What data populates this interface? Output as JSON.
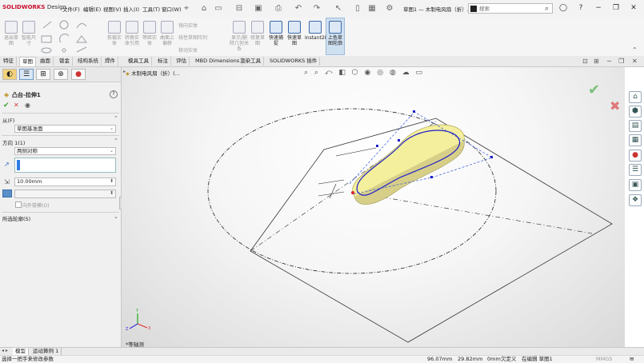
{
  "app": {
    "brand": "SOLIDWORKS",
    "brand_suffix": "Design",
    "menus": [
      "文件(F)",
      "编辑(E)",
      "视图(V)",
      "插入(I)",
      "工具(T)",
      "窗口(W)"
    ],
    "doc_title": "草图1 — 木制电风扇（折）...",
    "search_placeholder": "搜索"
  },
  "ribbon": {
    "groups": [
      {
        "label": "退出草图",
        "enabled": false
      },
      {
        "label": "智能尺寸",
        "enabled": false
      },
      {
        "label": "剪裁实体",
        "enabled": false
      },
      {
        "label": "转换实体引用",
        "enabled": false
      },
      {
        "label": "等距实体",
        "enabled": false
      },
      {
        "label": "曲面上偏移",
        "enabled": false
      },
      {
        "label": "修复草图",
        "enabled": false
      },
      {
        "label": "快速捕捉",
        "enabled": true
      },
      {
        "label": "快速草图",
        "enabled": true
      },
      {
        "label": "Instant2D",
        "enabled": true
      },
      {
        "label": "上色草图轮廓",
        "enabled": true
      }
    ],
    "small_items": [
      "镜向实体",
      "线性草图阵列",
      "移动实体",
      "显示/删除几何关系"
    ]
  },
  "tabs": [
    "特征",
    "草图",
    "曲面",
    "钣金",
    "结构系统",
    "焊件",
    "模具工具",
    "标注",
    "评估",
    "MBD Dimensions",
    "渲染工具",
    "SOLIDWORKS 插件"
  ],
  "active_tab": "草图",
  "property_manager": {
    "feature_title": "凸台-拉伸1",
    "help": "?",
    "from_label": "从(F)",
    "from_value": "草图基准面",
    "direction_label": "方向 1(1)",
    "direction_value": "两侧对称",
    "depth_value": "10.00mm",
    "draft_outward_label": "向外拔模(O)",
    "selected_contours_label": "所选轮廓(S)"
  },
  "graphics": {
    "breadcrumb": "木制电风扇（折）(...",
    "view_label": "*等轴测"
  },
  "bottom_tabs": [
    "模型",
    "运动算例 1"
  ],
  "active_bottom_tab": "模型",
  "status": {
    "hint": "选择一把手来修改参数",
    "x": "96.07mm",
    "y": "29.82mm",
    "z": "0mm",
    "state": "欠定义",
    "editing": "在编辑 草图1",
    "units": "MMGS"
  },
  "colors": {
    "accent": "#c8102e",
    "sketch_blue": "#1c1cc8",
    "face_yellow": "#f4ef9c",
    "ok_green": "#3aa23a",
    "cancel_red": "#d23a3a"
  },
  "icons": [
    "home-icon",
    "file-icon",
    "open-icon",
    "save-icon",
    "print-icon",
    "undo-icon",
    "redo-icon",
    "select-icon",
    "gear-icon",
    "search-icon",
    "help-icon",
    "user-icon",
    "zoom-fit-icon",
    "zoom-area-icon",
    "section-view-icon",
    "display-style-icon",
    "hide-show-icon",
    "appearance-icon",
    "scene-icon",
    "monitor-icon"
  ]
}
